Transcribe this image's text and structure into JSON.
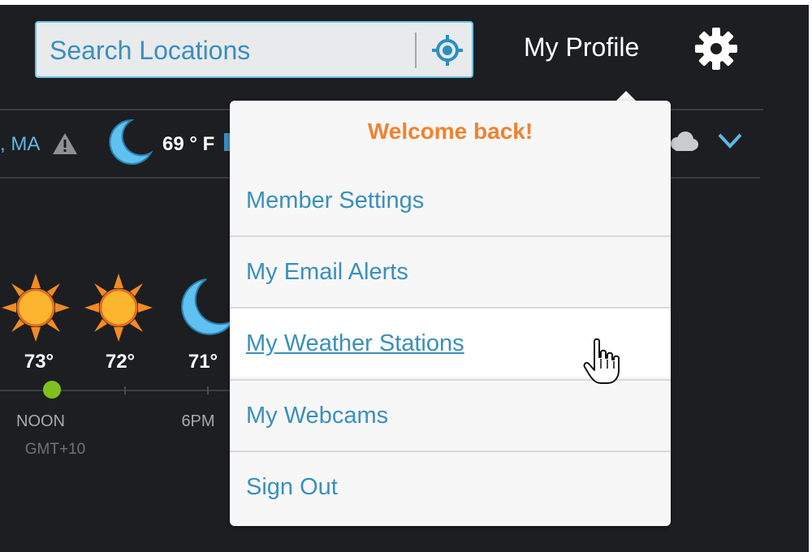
{
  "header": {
    "search": {
      "placeholder": "Search Locations",
      "value": ""
    },
    "profile_label": "My Profile"
  },
  "conditions": {
    "location_fragment": ", MA",
    "temperature": "69 ° F"
  },
  "forecast": {
    "temps": [
      "73°",
      "72°",
      "71°"
    ],
    "time_labels": [
      "NOON",
      "6PM"
    ],
    "timezone": "GMT+10"
  },
  "profile_menu": {
    "welcome": "Welcome back!",
    "items": [
      {
        "label": "Member Settings"
      },
      {
        "label": "My Email Alerts"
      },
      {
        "label": "My Weather Stations",
        "state": "hover"
      },
      {
        "label": "My Webcams"
      },
      {
        "label": "Sign Out"
      }
    ]
  },
  "colors": {
    "background": "#1d1e21",
    "accent_blue": "#3a8fbd",
    "welcome_orange": "#f08230",
    "now_marker_green": "#7ec11e",
    "sun_orange": "#f28b24",
    "moon_blue": "#5fc1ef"
  },
  "icons": [
    "locate-icon",
    "gear-icon",
    "warning-icon",
    "moon-icon",
    "sun-icon",
    "cloud-icon",
    "chevron-down-icon",
    "hand-cursor-icon"
  ]
}
